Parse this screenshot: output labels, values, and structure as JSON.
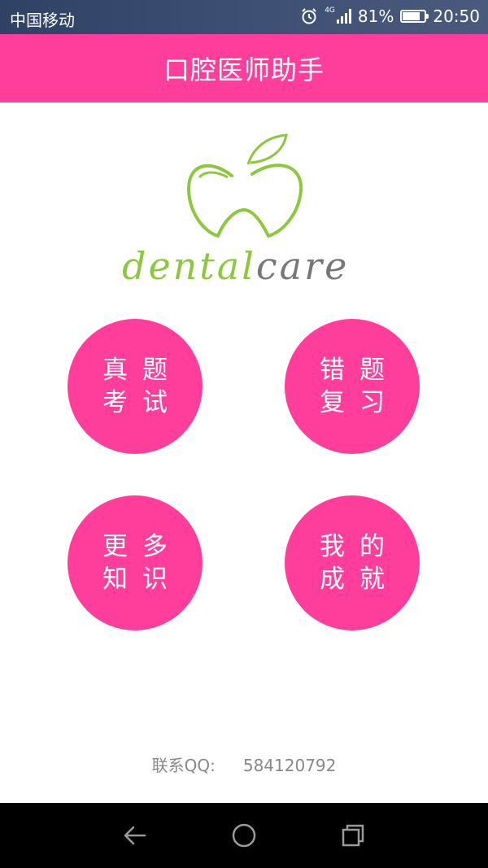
{
  "status_bar": {
    "carrier": "中国移动",
    "network": "4G",
    "battery": "81%",
    "battery_level": 0.81,
    "time": "20:50"
  },
  "app_bar": {
    "title": "口腔医师助手"
  },
  "logo": {
    "word_green": "dental",
    "word_gray": "care"
  },
  "menu": [
    {
      "line1": "真题",
      "line2": "考试"
    },
    {
      "line1": "错题",
      "line2": "复习"
    },
    {
      "line1": "更多",
      "line2": "知识"
    },
    {
      "line1": "我的",
      "line2": "成就"
    }
  ],
  "contact": {
    "label": "联系QQ:",
    "value": "584120792"
  },
  "colors": {
    "accent": "#ff3d9a",
    "logo_green": "#8cc83c",
    "logo_gray": "#777777"
  }
}
